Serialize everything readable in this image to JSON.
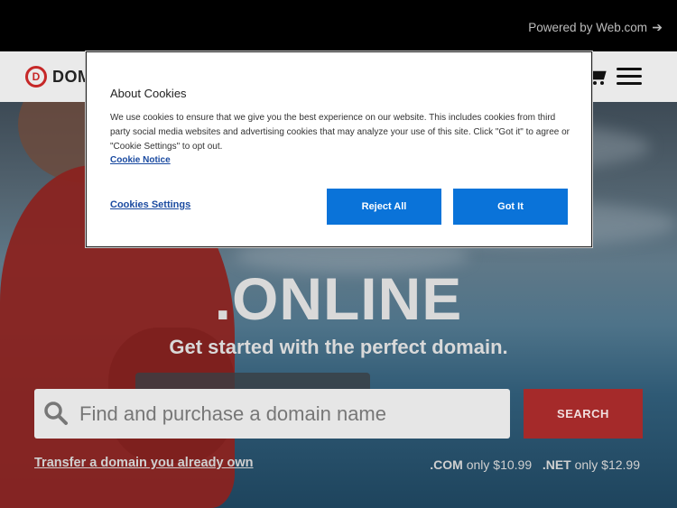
{
  "topbar": {
    "powered_by": "Powered by Web.com",
    "arrow": "➔"
  },
  "navbar": {
    "logo_mark": "D",
    "logo_text": "DOM"
  },
  "hero": {
    "headline": ".ONLINE",
    "subline": "Get started with the perfect domain.",
    "search_placeholder": "Find and purchase a domain name",
    "search_button": "SEARCH",
    "transfer_link": "Transfer a domain you already own",
    "price_com_tld": ".COM",
    "price_com_text": " only $10.99",
    "price_net_tld": ".NET",
    "price_net_text": " only $12.99"
  },
  "cookie_modal": {
    "title": "About Cookies",
    "body": "We use cookies to ensure that we give you the best experience on our website. This includes cookies from third party social media websites and advertising cookies that may analyze your use of this site. Click \"Got it\" to agree or \"Cookie Settings\" to opt out.",
    "notice_link": "Cookie Notice",
    "settings_link": "Cookies Settings",
    "reject_button": "Reject All",
    "accept_button": "Got It"
  },
  "colors": {
    "brand_red": "#a52a2a",
    "primary_blue": "#0a73d9"
  },
  "icons": [
    "arrow-right-icon",
    "logo-icon",
    "cart-icon",
    "menu-icon",
    "search-icon"
  ]
}
